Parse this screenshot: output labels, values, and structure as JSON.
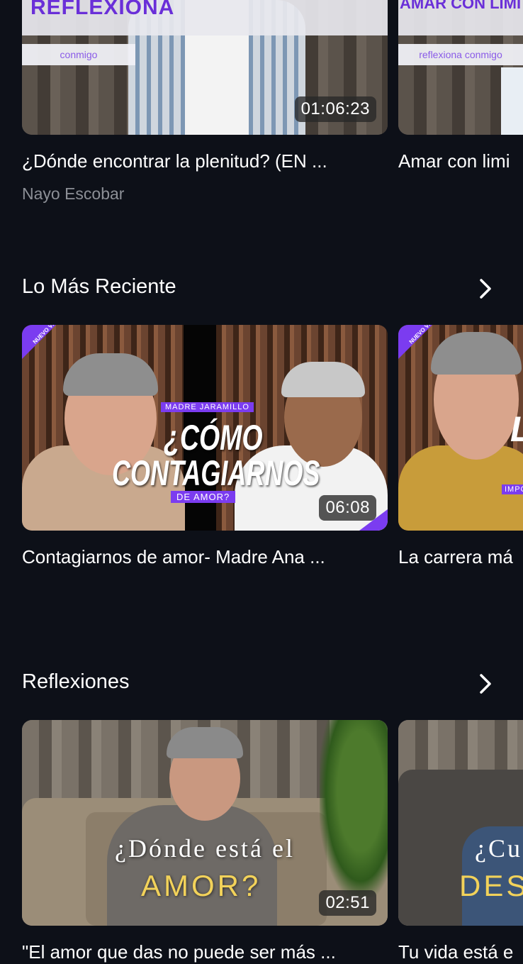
{
  "top_row": {
    "videos": [
      {
        "banner_text": "REFLEXIONA",
        "banner_sub": "conmigo",
        "duration": "01:06:23",
        "title": "¿Dónde encontrar la plenitud? (EN ...",
        "channel": "Nayo Escobar"
      },
      {
        "banner_text": "AMAR CON LIMITES",
        "banner_sub": "reflexiona conmigo",
        "title": "Amar con limi"
      }
    ]
  },
  "sections": [
    {
      "title": "Lo Más Reciente",
      "videos": [
        {
          "badge": "NUEVO VIDEO",
          "overlay_top": "MADRE JARAMILLO",
          "overlay_line1": "¿CÓMO",
          "overlay_line2": "CONTAGIARNOS",
          "overlay_bottom": "DE AMOR?",
          "duration": "06:08",
          "title": "Contagiarnos de amor- Madre Ana ..."
        },
        {
          "badge": "NUEVO VIDEO",
          "overlay_letter": "L",
          "overlay_tag": "IMPO",
          "title": "La carrera má"
        }
      ]
    },
    {
      "title": "Reflexiones",
      "videos": [
        {
          "overlay_line1": "¿Dónde está el",
          "overlay_line2": "AMOR?",
          "duration": "02:51",
          "title": "\"El amor que das no puede ser más ..."
        },
        {
          "overlay_line1": "¿Cu",
          "overlay_line2": "DES",
          "title": "Tu vida está e"
        }
      ]
    }
  ],
  "colors": {
    "background": "#0d1018",
    "accent_purple": "#7b3cf0",
    "gold": "#f2d25a",
    "muted_text": "#8c8f96"
  }
}
